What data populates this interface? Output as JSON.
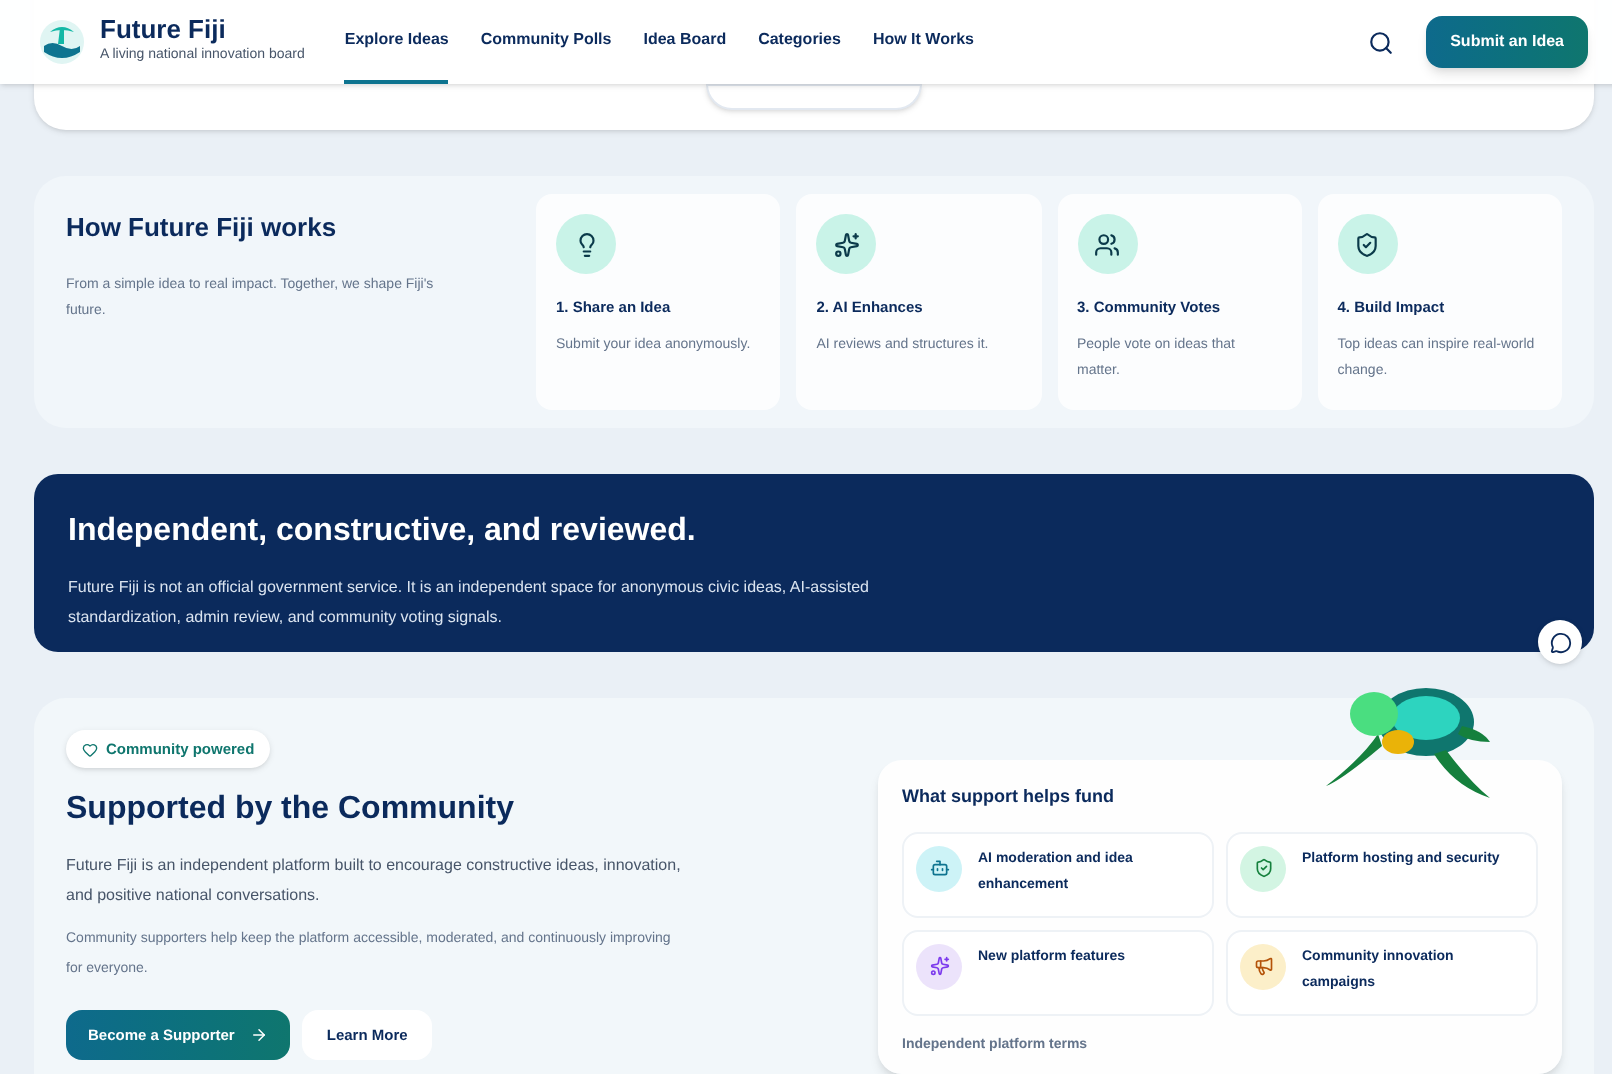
{
  "header": {
    "brand": "Future Fiji",
    "tagline": "A living national innovation board",
    "nav": [
      {
        "label": "Explore Ideas",
        "selected": true
      },
      {
        "label": "Community Polls",
        "selected": false
      },
      {
        "label": "Idea Board",
        "selected": false
      },
      {
        "label": "Categories",
        "selected": false
      },
      {
        "label": "How It Works",
        "selected": false
      }
    ],
    "cta": "Submit an Idea"
  },
  "how": {
    "title": "How Future Fiji works",
    "subtitle": "From a simple idea to real impact. Together, we shape Fiji's future.",
    "steps": [
      {
        "kind": "bulb",
        "title": "1. Share an Idea",
        "text": "Submit your idea anonymously."
      },
      {
        "kind": "sparkle",
        "title": "2. AI Enhances",
        "text": "AI reviews and structures it."
      },
      {
        "kind": "people",
        "title": "3. Community Votes",
        "text": "People vote on ideas that matter."
      },
      {
        "kind": "shield",
        "title": "4. Build Impact",
        "text": "Top ideas can inspire real-world change."
      }
    ]
  },
  "banner": {
    "title": "Independent, constructive, and reviewed.",
    "text": "Future Fiji is not an official government service. It is an independent space for anonymous civic ideas, AI-assisted standardization, admin review, and community voting signals."
  },
  "support": {
    "badge": "Community powered",
    "title": "Supported by the Community",
    "lead": "Future Fiji is an independent platform built to encourage constructive ideas, innovation, and positive national conversations.",
    "note": "Community supporters help keep the platform accessible, moderated, and continuously improving for everyone.",
    "primary": "Become a Supporter",
    "secondary": "Learn More",
    "fund": {
      "title": "What support helps fund",
      "items": [
        {
          "kind": "robot",
          "label": "AI moderation and idea enhancement",
          "color": "#cdf3f7"
        },
        {
          "kind": "shield",
          "label": "Platform hosting and security",
          "color": "#d3f5e3"
        },
        {
          "kind": "sparkle",
          "label": "New platform features",
          "color": "#ece3fb"
        },
        {
          "kind": "megaphone",
          "label": "Community innovation campaigns",
          "color": "#fcefc9"
        }
      ],
      "footer": "Independent platform terms"
    }
  }
}
